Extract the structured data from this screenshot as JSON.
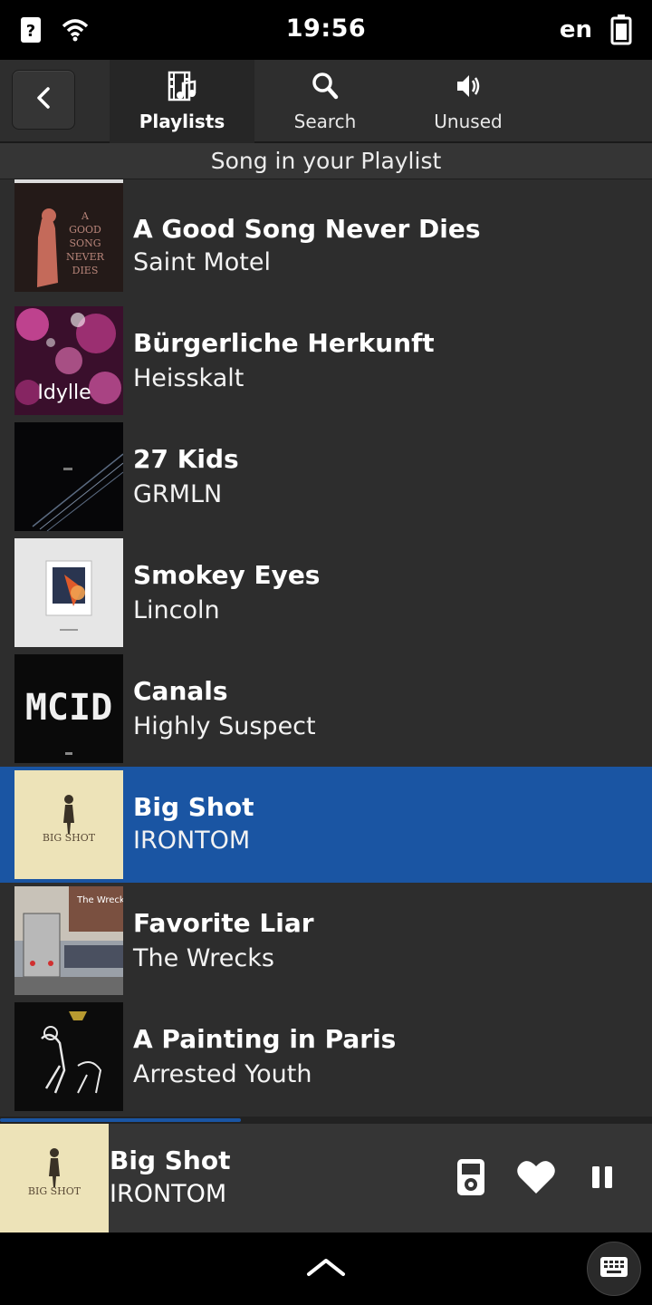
{
  "status_bar": {
    "time": "19:56",
    "language": "en",
    "icons": [
      "help-icon",
      "wifi-icon",
      "battery-icon"
    ]
  },
  "header": {
    "back_icon": "back-arrow-icon",
    "tabs": [
      {
        "label": "Playlists",
        "icon": "film-music-icon",
        "active": true
      },
      {
        "label": "Search",
        "icon": "search-icon",
        "active": false
      },
      {
        "label": "Unused",
        "icon": "speaker-icon",
        "active": false
      }
    ]
  },
  "section_title": "Song in your Playlist",
  "songs": [
    {
      "title": "A Good Song Never Dies",
      "artist": "Saint Motel",
      "art_lettering": "A GOOD SONG NEVER DIES"
    },
    {
      "title": "Bürgerliche Herkunft",
      "artist": "Heisskalt",
      "art_lettering": "Idylle"
    },
    {
      "title": "27 Kids",
      "artist": "GRMLN"
    },
    {
      "title": "Smokey Eyes",
      "artist": "Lincoln"
    },
    {
      "title": "Canals",
      "artist": "Highly Suspect",
      "art_lettering": "MCID"
    },
    {
      "title": "Big Shot",
      "artist": "IRONTOM",
      "selected": true,
      "art_lettering": "BIG SHOT"
    },
    {
      "title": "Favorite Liar",
      "artist": "The Wrecks",
      "art_lettering": "The Wrecks"
    },
    {
      "title": "A Painting in Paris",
      "artist": "Arrested Youth"
    }
  ],
  "now_playing": {
    "title": "Big Shot",
    "artist": "IRONTOM",
    "progress": 0.37,
    "controls": [
      "device-icon",
      "heart-icon",
      "pause-icon"
    ]
  },
  "bottom_bar": {
    "icons": [
      "chevron-up-icon",
      "keyboard-icon"
    ]
  },
  "colors": {
    "selection": "#1a55a3",
    "background": "#2d2d2d",
    "header": "#2e2e2e"
  }
}
